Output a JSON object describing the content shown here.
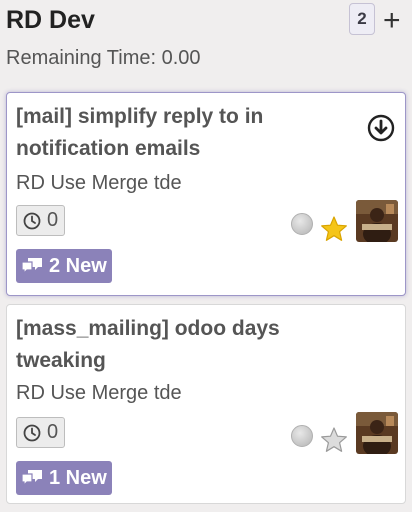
{
  "column": {
    "title": "RD Dev",
    "count": "2",
    "add_label": "+",
    "remaining": "Remaining Time: 0.00"
  },
  "cards": [
    {
      "title_line1": "[mail] simplify reply to in",
      "title_line2": "notification emails",
      "subtitle": "RD Use Merge tde",
      "hours": "0",
      "new_label": "2 New",
      "starred": true,
      "selected": true
    },
    {
      "title_line1": "[mass_mailing] odoo days",
      "title_line2": "tweaking",
      "subtitle": "RD Use Merge tde",
      "hours": "0",
      "new_label": "1 New",
      "starred": false,
      "selected": false
    }
  ],
  "colors": {
    "accent": "#8b82b9",
    "star_active": "#f5c518",
    "star_inactive": "#c8c8c8"
  }
}
